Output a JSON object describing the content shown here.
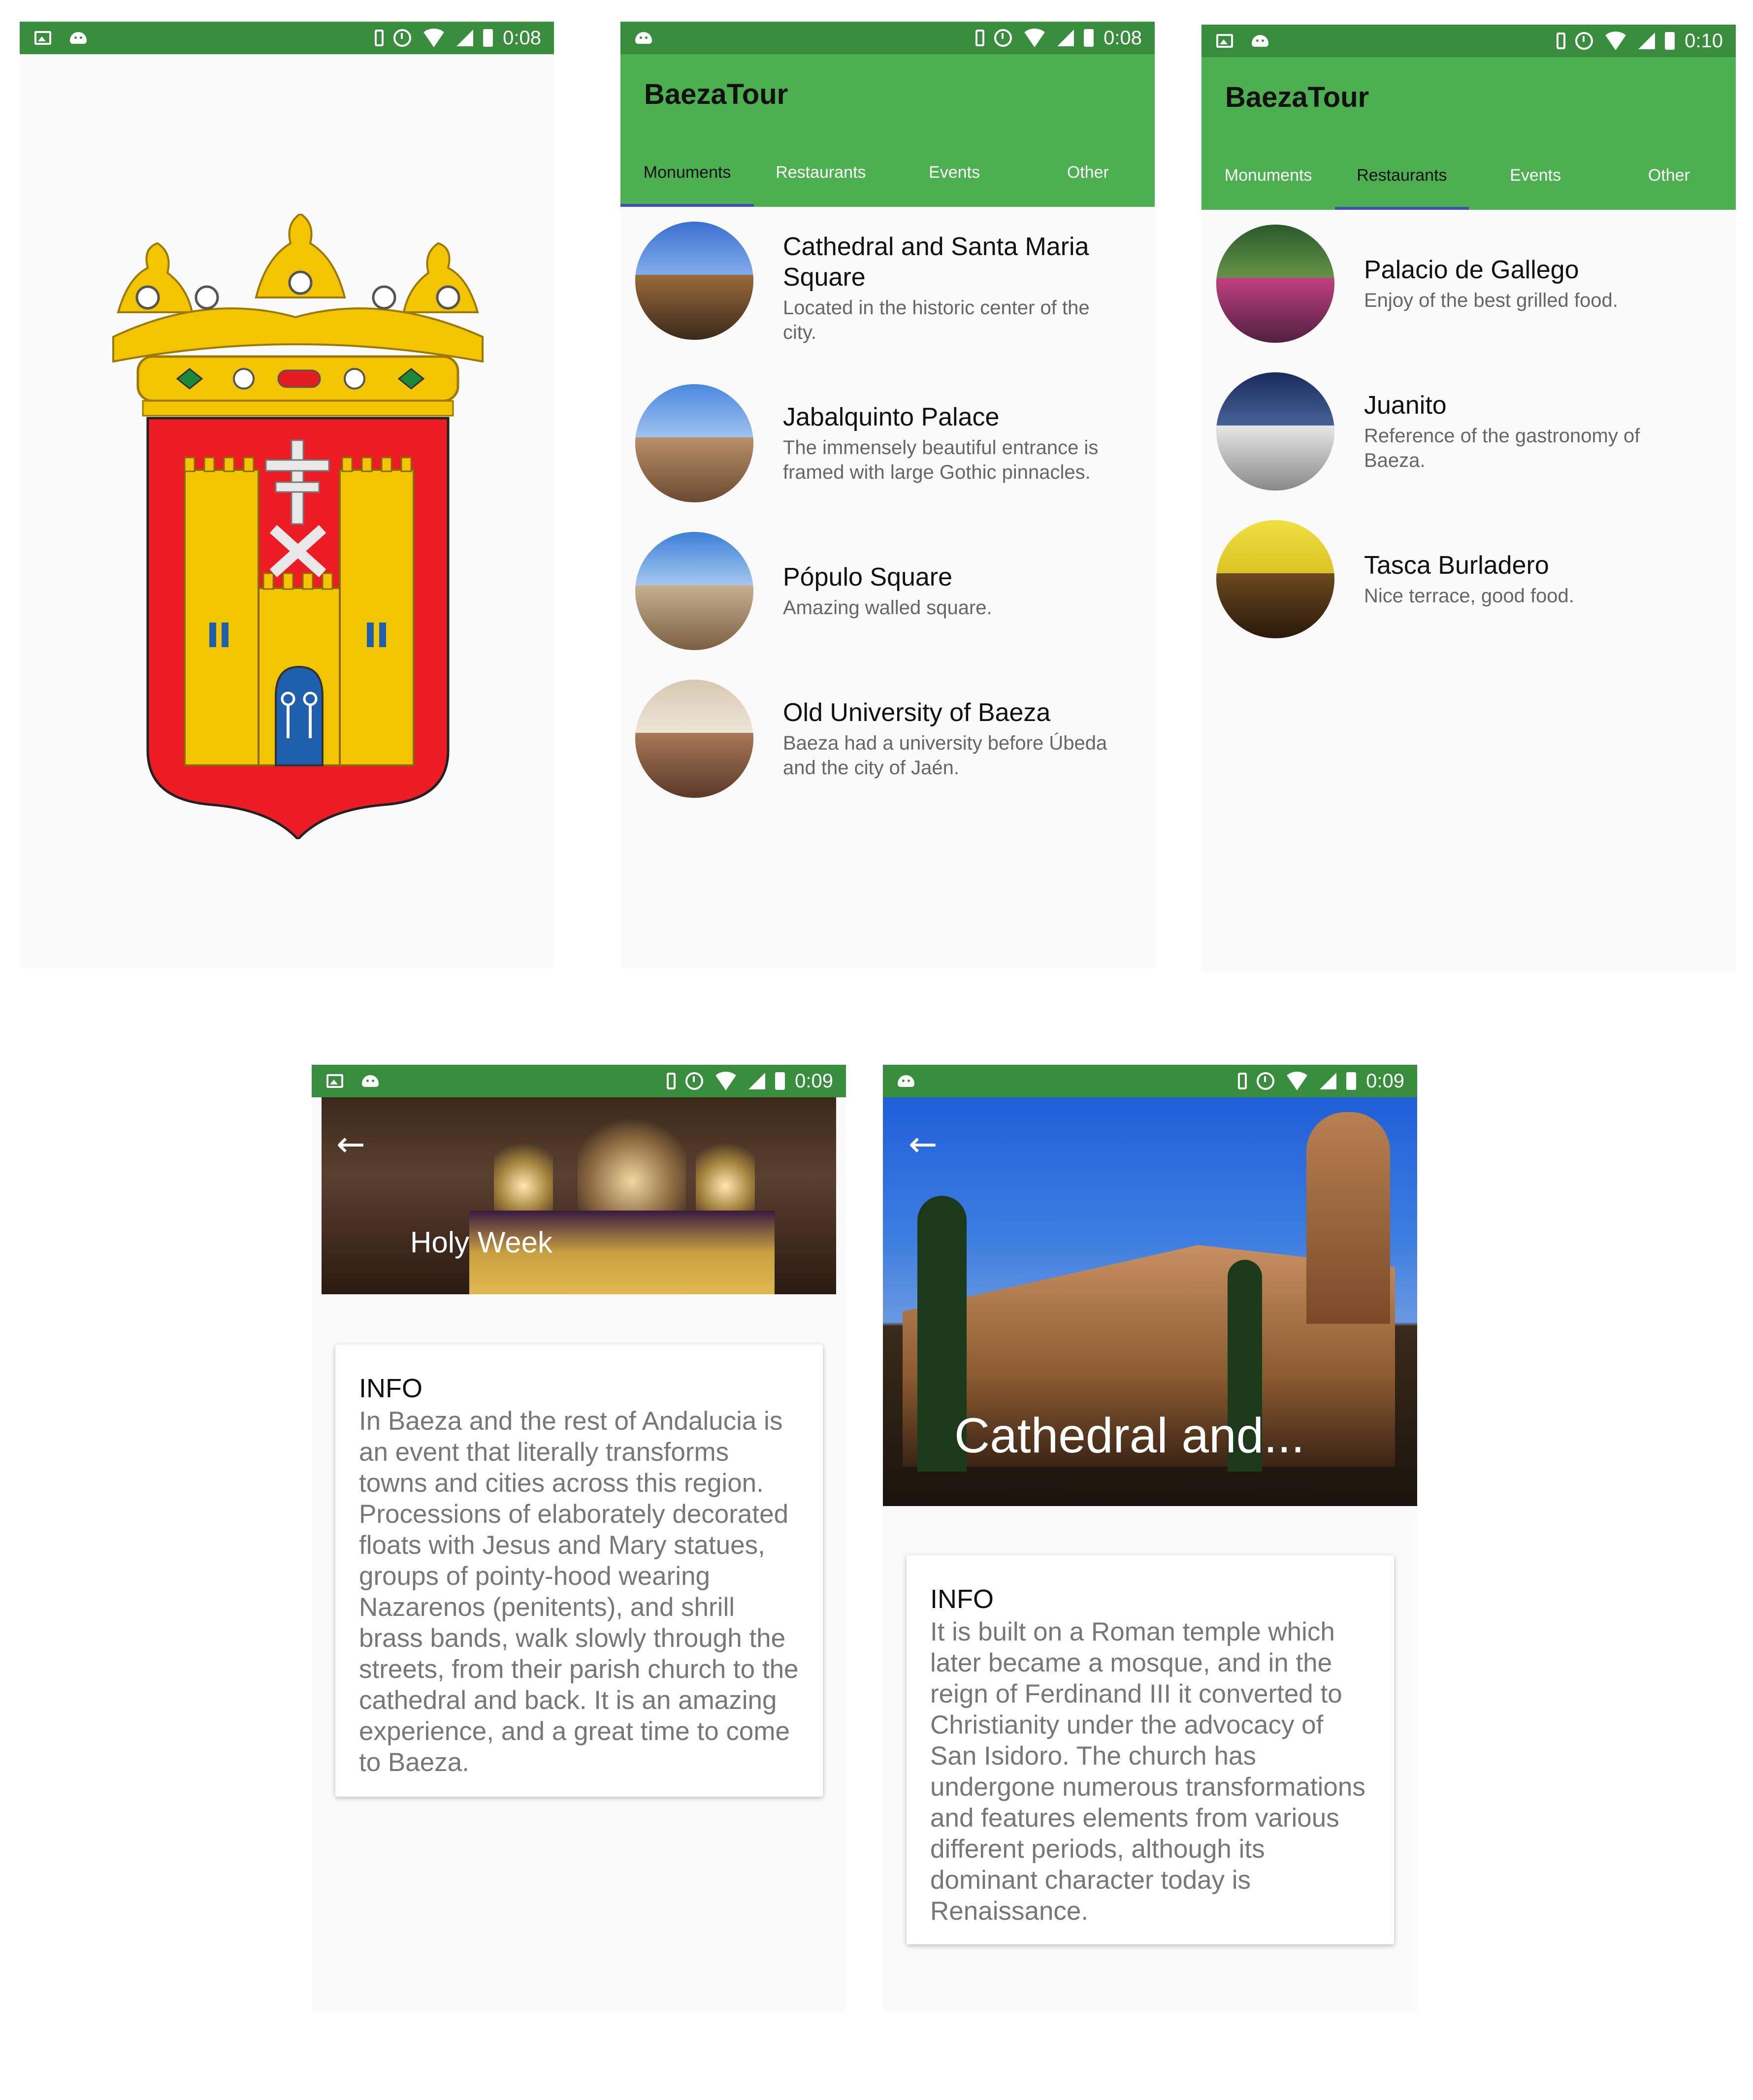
{
  "splash": {
    "time": "0:08"
  },
  "monuments_screen": {
    "time": "0:08",
    "app_title": "BaezaTour",
    "tabs": [
      "Monuments",
      "Restaurants",
      "Events",
      "Other"
    ],
    "active_tab": "Monuments",
    "items": [
      {
        "title": "Cathedral and Santa Maria Square",
        "description": "Located in the historic center of the city."
      },
      {
        "title": "Jabalquinto Palace",
        "description": "The immensely beautiful entrance is framed with large Gothic pinnacles."
      },
      {
        "title": "Pópulo Square",
        "description": "Amazing walled square."
      },
      {
        "title": "Old University of Baeza",
        "description": "Baeza had a university before Úbeda and the city of Jaén."
      }
    ]
  },
  "restaurants_screen": {
    "time": "0:10",
    "app_title": "BaezaTour",
    "tabs": [
      "Monuments",
      "Restaurants",
      "Events",
      "Other"
    ],
    "active_tab": "Restaurants",
    "items": [
      {
        "title": "Palacio de Gallego",
        "description": "Enjoy of the best grilled food."
      },
      {
        "title": "Juanito",
        "description": "Reference of the gastronomy of Baeza."
      },
      {
        "title": "Tasca Burladero",
        "description": "Nice terrace, good food."
      }
    ]
  },
  "holy_week_screen": {
    "time": "0:09",
    "title": "Holy Week",
    "card_title": "INFO",
    "card_body": "In Baeza and the rest of Andalucia is an event that literally transforms towns and cities across this region. Processions of elaborately decorated floats with Jesus and Mary statues, groups of pointy-hood wearing Nazarenos (penitents), and shrill brass bands, walk slowly through the streets, from their parish church to the cathedral and back. It is an amazing experience, and a great time to come to Baeza."
  },
  "cathedral_screen": {
    "time": "0:09",
    "title": "Cathedral and...",
    "card_title": "INFO",
    "card_body": "It is built on a Roman temple which later became a mosque, and in the reign of Ferdinand III it converted to Christianity under the advocacy of San Isidoro. The church has undergone numerous transformations and features elements from various different periods, although its dominant character today is Renaissance."
  },
  "colors": {
    "status_bar": "#388e3c",
    "app_bar": "#4caf50",
    "tab_indicator": "#3f51b5",
    "shield_red": "#ed1c24",
    "shield_gold": "#f2c500"
  }
}
